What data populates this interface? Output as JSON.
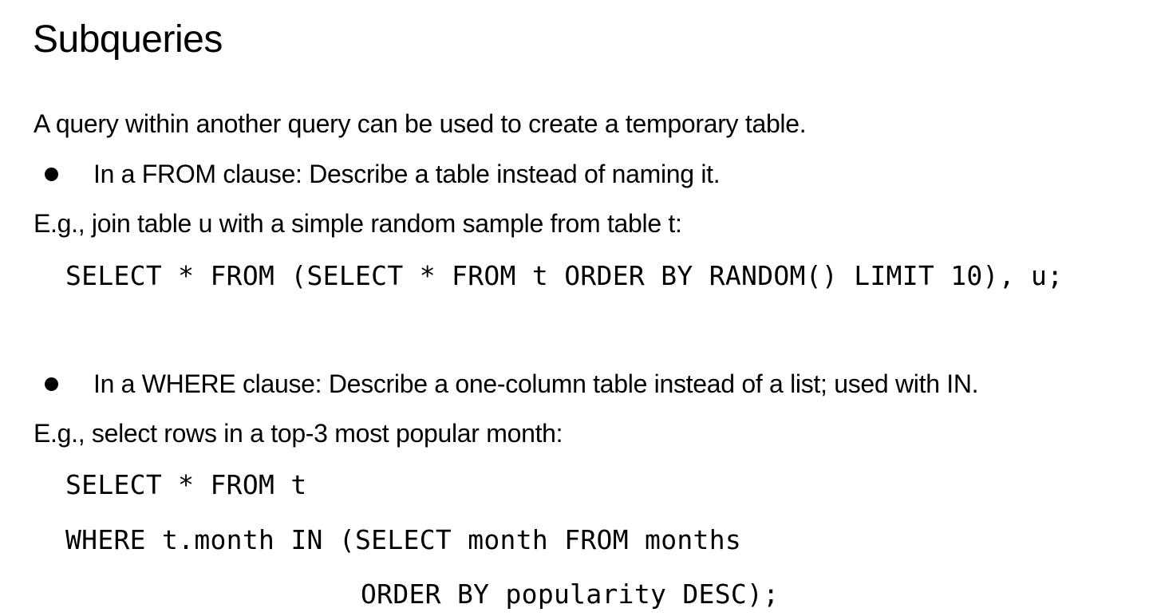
{
  "title": "Subqueries",
  "intro": "A query within another query can be used to create a temporary table.",
  "bullets": [
    {
      "text": "In a FROM clause: Describe a table instead of naming it.",
      "example_label": "E.g., join table u with a simple random sample from table t:",
      "code_lines": [
        "SELECT * FROM (SELECT * FROM t ORDER BY RANDOM() LIMIT 10), u;"
      ]
    },
    {
      "text": "In a WHERE clause: Describe a one-column table instead of a list; used with IN.",
      "example_label": "E.g., select rows in a top-3 most popular month:",
      "code_lines": [
        "SELECT * FROM t",
        "WHERE t.month IN (SELECT month FROM months",
        "ORDER BY popularity DESC);"
      ]
    }
  ]
}
